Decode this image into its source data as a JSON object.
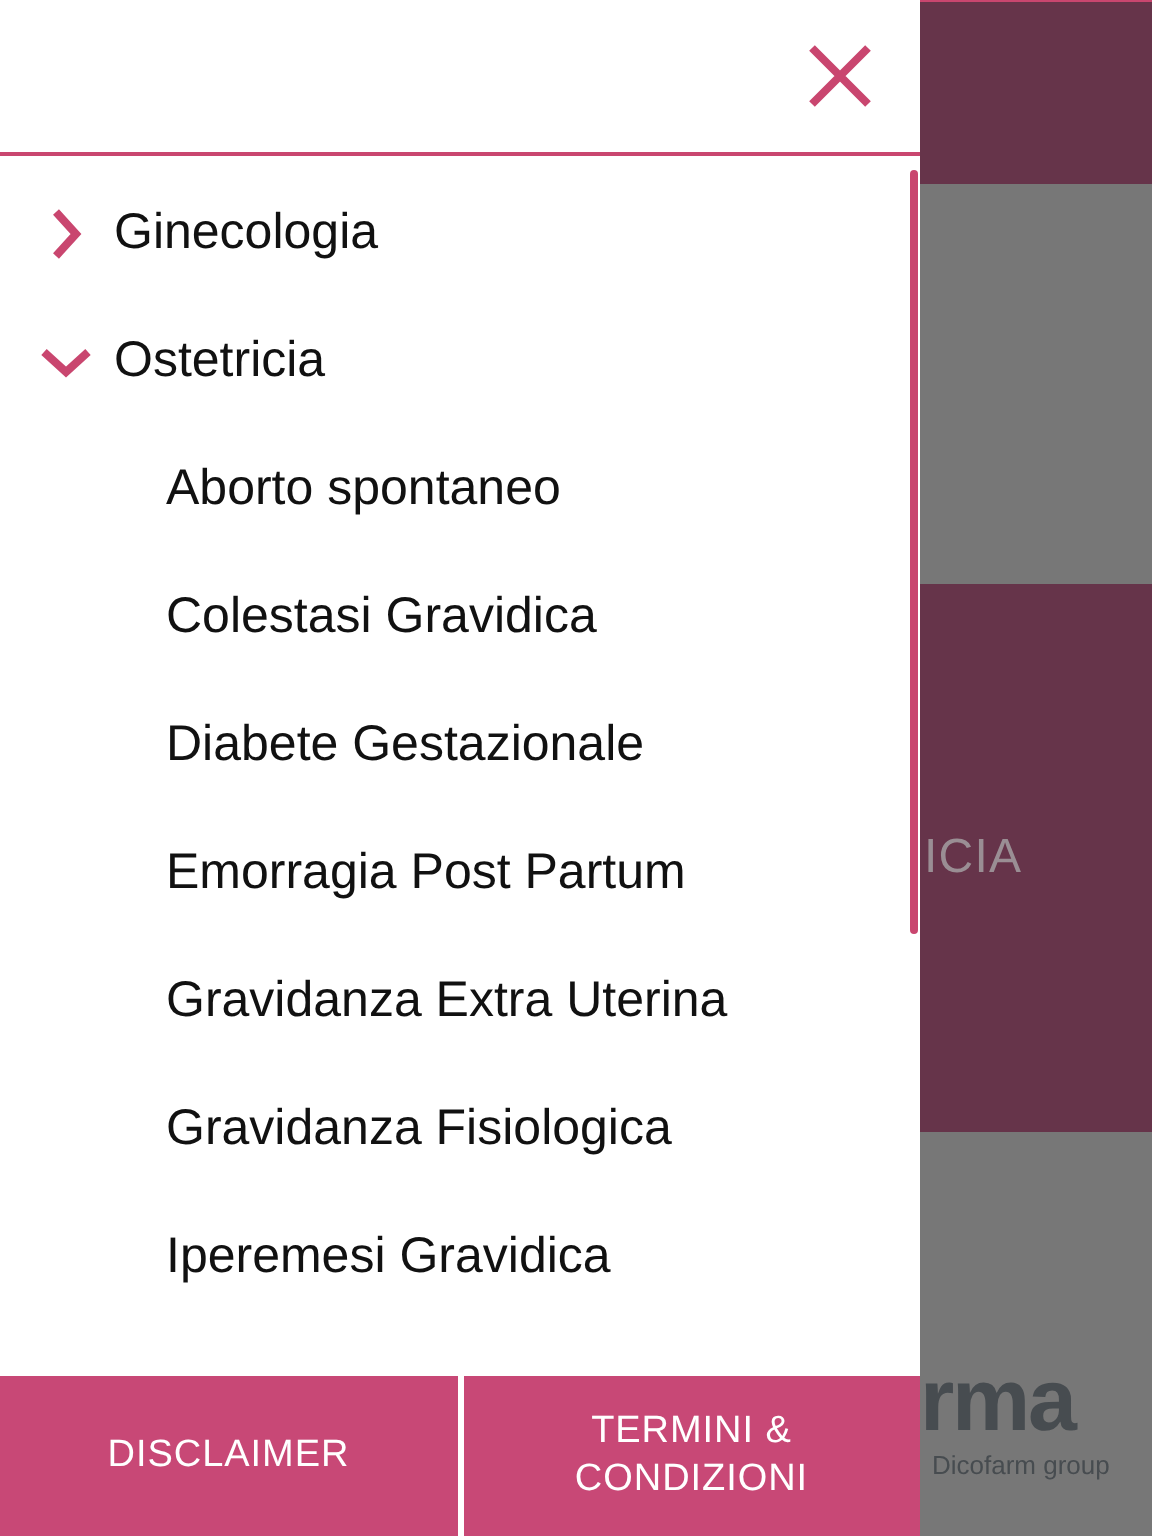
{
  "menu": {
    "items": [
      {
        "label": "Ginecologia",
        "expanded": false
      },
      {
        "label": "Ostetricia",
        "expanded": true,
        "children": [
          {
            "label": "Aborto spontaneo"
          },
          {
            "label": "Colestasi Gravidica"
          },
          {
            "label": "Diabete Gestazionale"
          },
          {
            "label": "Emorragia Post Partum"
          },
          {
            "label": "Gravidanza Extra Uterina"
          },
          {
            "label": "Gravidanza Fisiologica"
          },
          {
            "label": "Iperemesi Gravidica"
          }
        ]
      }
    ]
  },
  "footer": {
    "buttons": [
      "DISCLAIMER",
      "TERMINI & CONDIZIONI"
    ]
  },
  "background": {
    "banner_text": "ICIA",
    "logo_text": "rma",
    "logo_subtitle": "Dicofarm group"
  }
}
